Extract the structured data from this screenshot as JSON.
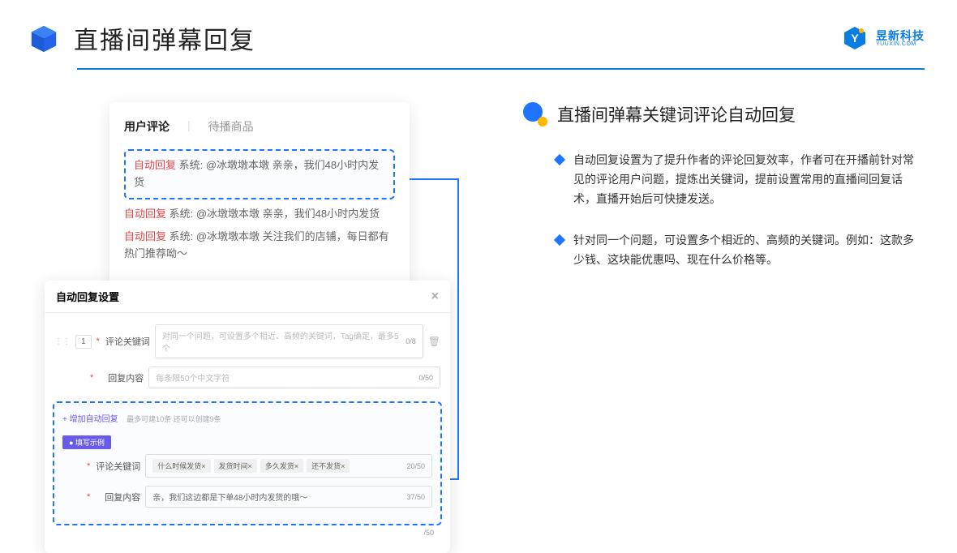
{
  "header": {
    "title": "直播间弹幕回复"
  },
  "logo": {
    "cn": "昱新科技",
    "en": "YUUXIN.COM"
  },
  "cardA": {
    "tabs": {
      "active": "用户评论",
      "inactive": "待播商品"
    },
    "highlighted": {
      "tag": "自动回复",
      "text": " 系统: @冰墩墩本墩 亲亲，我们48小时内发货"
    },
    "c2": {
      "tag": "自动回复",
      "text": " 系统: @冰墩墩本墩 亲亲，我们48小时内发货"
    },
    "c3": {
      "tag": "自动回复",
      "text": " 系统: @冰墩墩本墩 关注我们的店铺，每日都有热门推荐呦～"
    }
  },
  "cardB": {
    "title": "自动回复设置",
    "num": "1",
    "row1": {
      "label": "评论关键词",
      "placeholder": "对同一个问题，可设置多个相近、高频的关键词，Tag确定，最多5个",
      "count": "0/8"
    },
    "row2": {
      "label": "回复内容",
      "placeholder": "每条限50个中文字符",
      "count": "0/50"
    },
    "add": {
      "link": "+ 增加自动回复",
      "hint": "最多可建10条 还可以创建9条"
    },
    "example": {
      "badge": "● 填写示例",
      "kw": {
        "label": "评论关键词",
        "tags": [
          "什么时候发货×",
          "发货时间×",
          "多久发货×",
          "还不发货×"
        ],
        "count": "20/50"
      },
      "rp": {
        "label": "回复内容",
        "text": "亲，我们这边都是下单48小时内发货的哦～",
        "count": "37/50"
      }
    },
    "trailing": "/50"
  },
  "right": {
    "title": "直播间弹幕关键词评论自动回复",
    "b1": "自动回复设置为了提升作者的评论回复效率，作者可在开播前针对常见的评论用户问题，提炼出关键词，提前设置常用的直播间回复话术，直播开始后可快捷发送。",
    "b2": "针对同一个问题，可设置多个相近的、高频的关键词。例如：这款多少钱、这块能优惠吗、现在什么价格等。"
  }
}
